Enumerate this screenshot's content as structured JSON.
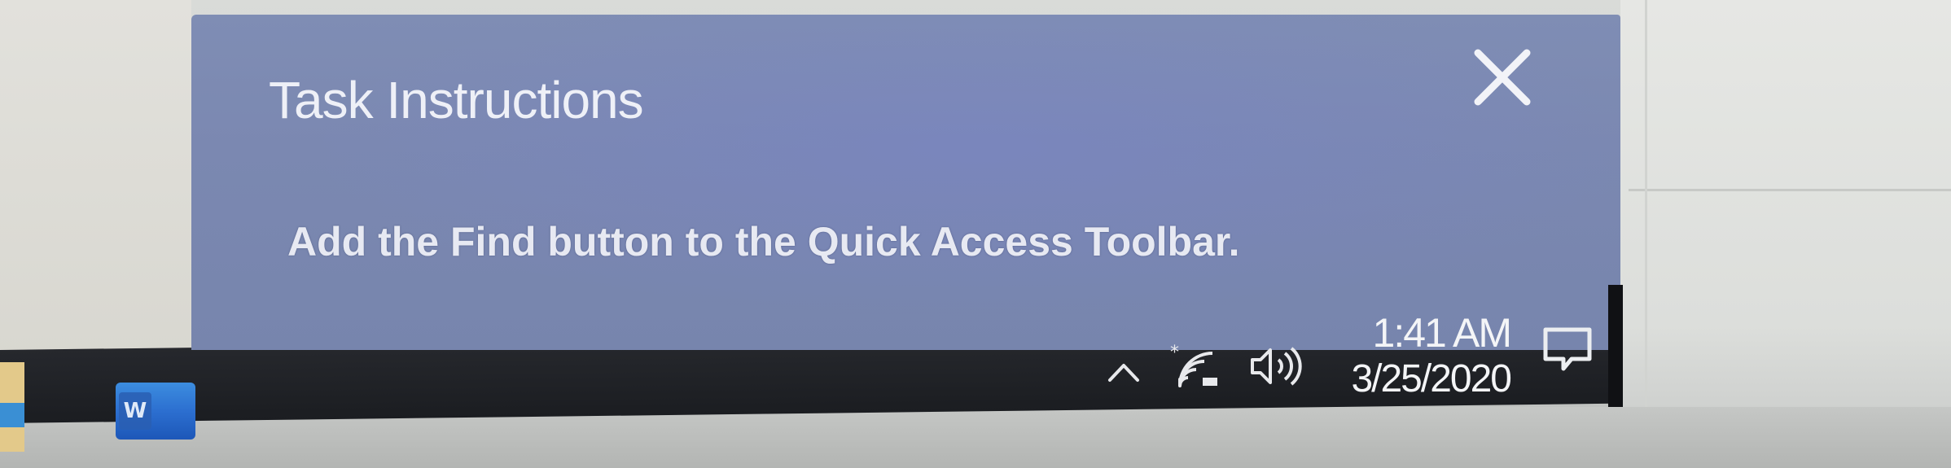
{
  "task_panel": {
    "title": "Task Instructions",
    "instruction": "Add the Find button to the Quick Access Toolbar.",
    "close_icon": "close-icon"
  },
  "taskbar": {
    "apps": [
      {
        "name": "Word",
        "letter": "W",
        "icon": "word-icon"
      }
    ],
    "tray": {
      "chevron_icon": "chevron-up-icon",
      "wifi_icon": "wifi-icon",
      "volume_icon": "volume-icon",
      "time": "1:41 AM",
      "date": "3/25/2020",
      "notification_icon": "action-center-icon"
    }
  },
  "colors": {
    "panel_bg": "#7b88b1",
    "taskbar_bg": "#1f2126",
    "text_light": "#f4f5f7"
  }
}
